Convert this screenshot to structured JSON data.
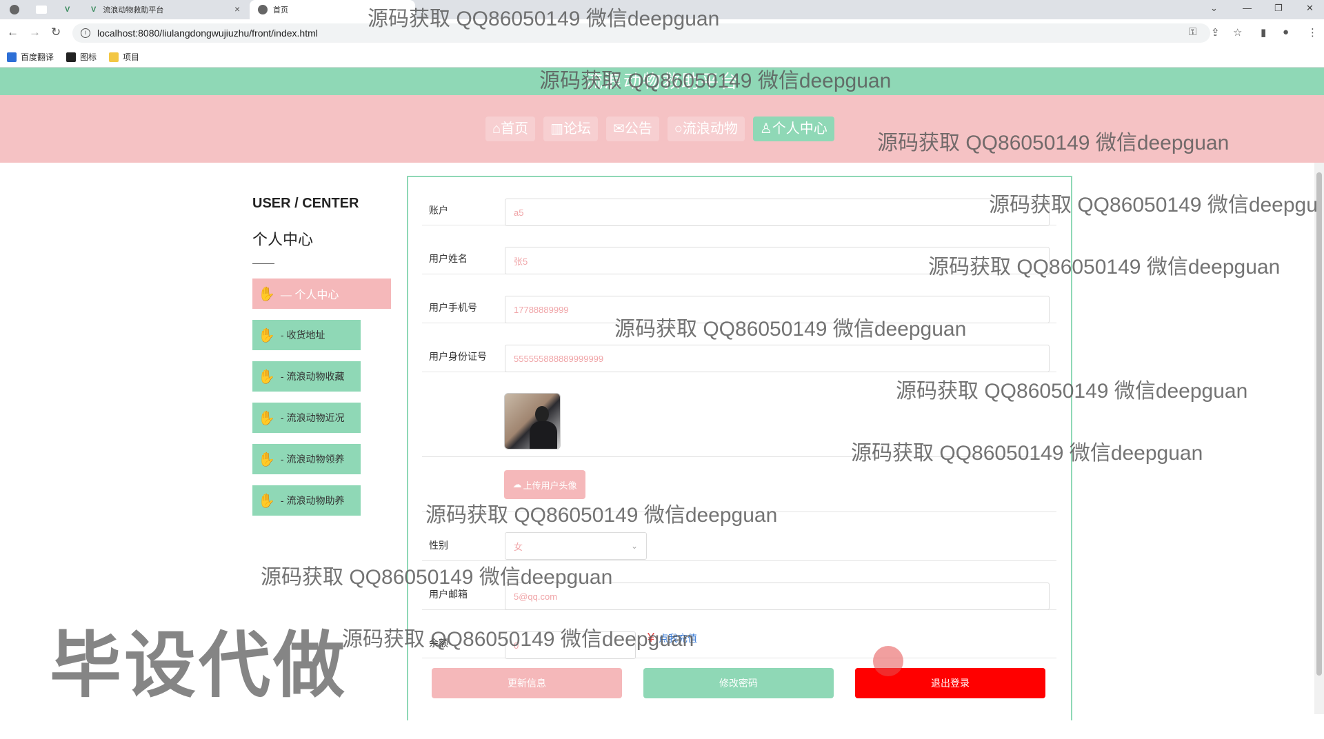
{
  "browser": {
    "tabs": [
      {
        "label": ""
      },
      {
        "label": ""
      },
      {
        "label": "流浪动物救助平台"
      },
      {
        "label": "首页"
      }
    ],
    "url": "localhost:8080/liulangdongwujiuzhu/front/index.html",
    "bookmarks": [
      "百度翻译",
      "图标",
      "项目"
    ]
  },
  "site": {
    "title": "流浪动物救助平台"
  },
  "nav": [
    {
      "icon": "home-icon",
      "label": "⌂首页"
    },
    {
      "icon": "forum-icon",
      "label": "▥论坛"
    },
    {
      "icon": "notice-icon",
      "label": "✉公告"
    },
    {
      "icon": "animal-icon",
      "label": "○流浪动物"
    },
    {
      "icon": "user-icon",
      "label": "♙个人中心"
    }
  ],
  "sidebar": {
    "title": "USER / CENTER",
    "subtitle": "个人中心",
    "items": [
      {
        "label": "— 个人中心"
      },
      {
        "label": "- 收货地址"
      },
      {
        "label": "- 流浪动物收藏"
      },
      {
        "label": "- 流浪动物近况"
      },
      {
        "label": "- 流浪动物领养"
      },
      {
        "label": "- 流浪动物助养"
      }
    ]
  },
  "form": {
    "account": {
      "label": "账户",
      "value": "a5"
    },
    "name": {
      "label": "用户姓名",
      "value": "张5"
    },
    "phone": {
      "label": "用户手机号",
      "value": "17788889999"
    },
    "idcard": {
      "label": "用户身份证号",
      "value": "555555888889999999"
    },
    "upload_label": "上传用户头像",
    "gender": {
      "label": "性别",
      "value": "女"
    },
    "email": {
      "label": "用户邮箱",
      "value": "5@qq.com"
    },
    "balance": {
      "label": "余额",
      "value": "0"
    },
    "recharge_label": "点我充值",
    "buttons": {
      "update": "更新信息",
      "password": "修改密码",
      "logout": "退出登录"
    }
  },
  "watermark": {
    "text": "源码获取 QQ86050149 微信deepguan",
    "text_cut": "源码获取 QQ86050149 微信deepgu",
    "big": "毕设代做"
  }
}
